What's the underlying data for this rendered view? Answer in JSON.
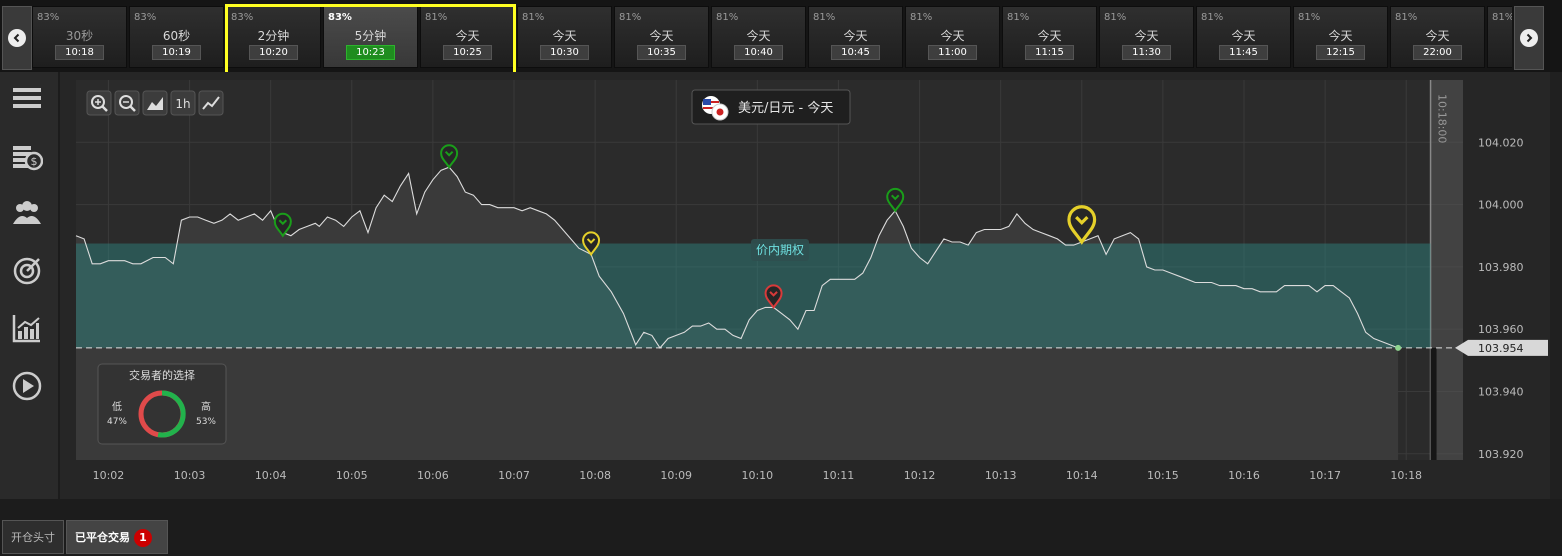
{
  "expiries": [
    {
      "pct": "83%",
      "label": "30秒",
      "time": "10:18"
    },
    {
      "pct": "83%",
      "label": "60秒",
      "time": "10:19"
    },
    {
      "pct": "83%",
      "label": "2分钟",
      "time": "10:20"
    },
    {
      "pct": "83%",
      "label": "5分钟",
      "time": "10:23",
      "selected": true
    },
    {
      "pct": "81%",
      "label": "今天",
      "time": "10:25"
    },
    {
      "pct": "81%",
      "label": "今天",
      "time": "10:30"
    },
    {
      "pct": "81%",
      "label": "今天",
      "time": "10:35"
    },
    {
      "pct": "81%",
      "label": "今天",
      "time": "10:40"
    },
    {
      "pct": "81%",
      "label": "今天",
      "time": "10:45"
    },
    {
      "pct": "81%",
      "label": "今天",
      "time": "11:00"
    },
    {
      "pct": "81%",
      "label": "今天",
      "time": "11:15"
    },
    {
      "pct": "81%",
      "label": "今天",
      "time": "11:30"
    },
    {
      "pct": "81%",
      "label": "今天",
      "time": "11:45"
    },
    {
      "pct": "81%",
      "label": "今天",
      "time": "12:15"
    },
    {
      "pct": "81%",
      "label": "今天",
      "time": "22:00"
    },
    {
      "pct": "81%",
      "label": "",
      "time": ""
    }
  ],
  "sidebar": {
    "icons": [
      "menu-icon",
      "coins-icon",
      "users-icon",
      "target-icon",
      "chart-icon",
      "play-icon"
    ]
  },
  "chart": {
    "toolbar": {
      "zoom_in": "zoom-in-icon",
      "zoom_out": "zoom-out-icon",
      "area": "area-chart-icon",
      "interval": "1h",
      "line": "line-chart-icon"
    },
    "asset_label": "美元/日元 - 今天",
    "expiry_marker": "10:18:00",
    "itm_label": "价内期权",
    "current_price_label": "103.954",
    "sentiment": {
      "title": "交易者的选择",
      "low_label": "低",
      "low_pct": "47%",
      "high_label": "高",
      "high_pct": "53%",
      "low_value": 47,
      "high_value": 53
    }
  },
  "chart_data": {
    "type": "line",
    "x_ticks": [
      "10:02",
      "10:03",
      "10:04",
      "10:05",
      "10:06",
      "10:07",
      "10:08",
      "10:09",
      "10:10",
      "10:11",
      "10:12",
      "10:13",
      "10:14",
      "10:15",
      "10:16",
      "10:17",
      "10:18"
    ],
    "y_ticks": [
      "104.020",
      "104.000",
      "103.980",
      "103.960",
      "103.940",
      "103.920"
    ],
    "ylim": [
      103.918,
      104.04
    ],
    "xlim_min": [
      1.6,
      18.7
    ],
    "current_price": 103.954,
    "itm_top": 103.9875,
    "expiry_min": 18.3,
    "series": [
      {
        "values": [
          [
            1.6,
            103.99
          ],
          [
            1.7,
            103.989
          ],
          [
            1.8,
            103.981
          ],
          [
            1.9,
            103.981
          ],
          [
            2.0,
            103.982
          ],
          [
            2.2,
            103.982
          ],
          [
            2.3,
            103.981
          ],
          [
            2.4,
            103.981
          ],
          [
            2.55,
            103.983
          ],
          [
            2.7,
            103.983
          ],
          [
            2.8,
            103.981
          ],
          [
            2.9,
            103.995
          ],
          [
            3.0,
            103.996
          ],
          [
            3.1,
            103.996
          ],
          [
            3.2,
            103.995
          ],
          [
            3.3,
            103.994
          ],
          [
            3.4,
            103.995
          ],
          [
            3.5,
            103.997
          ],
          [
            3.6,
            103.995
          ],
          [
            3.7,
            103.996
          ],
          [
            3.8,
            103.997
          ],
          [
            3.9,
            103.995
          ],
          [
            4.0,
            103.998
          ],
          [
            4.05,
            103.995
          ],
          [
            4.15,
            103.991
          ],
          [
            4.25,
            103.99
          ],
          [
            4.35,
            103.992
          ],
          [
            4.45,
            103.993
          ],
          [
            4.55,
            103.994
          ],
          [
            4.6,
            103.993
          ],
          [
            4.7,
            103.996
          ],
          [
            4.8,
            103.995
          ],
          [
            4.9,
            103.993
          ],
          [
            5.0,
            103.996
          ],
          [
            5.1,
            103.998
          ],
          [
            5.2,
            103.991
          ],
          [
            5.3,
            103.999
          ],
          [
            5.4,
            104.003
          ],
          [
            5.5,
            104.001
          ],
          [
            5.6,
            104.006
          ],
          [
            5.7,
            104.01
          ],
          [
            5.8,
            103.997
          ],
          [
            5.9,
            104.004
          ],
          [
            6.0,
            104.008
          ],
          [
            6.1,
            104.011
          ],
          [
            6.2,
            104.012
          ],
          [
            6.3,
            104.009
          ],
          [
            6.4,
            104.004
          ],
          [
            6.5,
            104.003
          ],
          [
            6.6,
            104.0
          ],
          [
            6.7,
            104.0
          ],
          [
            6.8,
            103.999
          ],
          [
            6.9,
            103.999
          ],
          [
            7.0,
            103.999
          ],
          [
            7.1,
            103.998
          ],
          [
            7.2,
            103.999
          ],
          [
            7.3,
            103.998
          ],
          [
            7.4,
            103.997
          ],
          [
            7.5,
            103.995
          ],
          [
            7.6,
            103.992
          ],
          [
            7.8,
            103.986
          ],
          [
            7.95,
            103.984
          ],
          [
            8.05,
            103.977
          ],
          [
            8.2,
            103.972
          ],
          [
            8.35,
            103.965
          ],
          [
            8.5,
            103.955
          ],
          [
            8.6,
            103.959
          ],
          [
            8.7,
            103.958
          ],
          [
            8.8,
            103.954
          ],
          [
            8.9,
            103.957
          ],
          [
            9.0,
            103.958
          ],
          [
            9.1,
            103.959
          ],
          [
            9.2,
            103.961
          ],
          [
            9.3,
            103.961
          ],
          [
            9.4,
            103.962
          ],
          [
            9.5,
            103.96
          ],
          [
            9.6,
            103.96
          ],
          [
            9.7,
            103.958
          ],
          [
            9.8,
            103.957
          ],
          [
            9.9,
            103.963
          ],
          [
            10.0,
            103.966
          ],
          [
            10.1,
            103.967
          ],
          [
            10.2,
            103.967
          ],
          [
            10.3,
            103.965
          ],
          [
            10.4,
            103.963
          ],
          [
            10.5,
            103.96
          ],
          [
            10.6,
            103.966
          ],
          [
            10.7,
            103.966
          ],
          [
            10.8,
            103.974
          ],
          [
            10.9,
            103.976
          ],
          [
            11.0,
            103.976
          ],
          [
            11.1,
            103.976
          ],
          [
            11.2,
            103.976
          ],
          [
            11.3,
            103.978
          ],
          [
            11.4,
            103.983
          ],
          [
            11.5,
            103.99
          ],
          [
            11.6,
            103.995
          ],
          [
            11.7,
            103.998
          ],
          [
            11.8,
            103.993
          ],
          [
            11.9,
            103.986
          ],
          [
            12.0,
            103.983
          ],
          [
            12.1,
            103.981
          ],
          [
            12.2,
            103.985
          ],
          [
            12.3,
            103.989
          ],
          [
            12.4,
            103.988
          ],
          [
            12.5,
            103.988
          ],
          [
            12.6,
            103.987
          ],
          [
            12.7,
            103.991
          ],
          [
            12.8,
            103.992
          ],
          [
            12.9,
            103.992
          ],
          [
            13.0,
            103.992
          ],
          [
            13.1,
            103.993
          ],
          [
            13.2,
            103.997
          ],
          [
            13.3,
            103.994
          ],
          [
            13.4,
            103.992
          ],
          [
            13.5,
            103.991
          ],
          [
            13.6,
            103.99
          ],
          [
            13.7,
            103.989
          ],
          [
            13.8,
            103.987
          ],
          [
            13.9,
            103.987
          ],
          [
            14.0,
            103.988
          ],
          [
            14.1,
            103.989
          ],
          [
            14.2,
            103.99
          ],
          [
            14.3,
            103.984
          ],
          [
            14.4,
            103.989
          ],
          [
            14.5,
            103.99
          ],
          [
            14.6,
            103.991
          ],
          [
            14.7,
            103.989
          ],
          [
            14.8,
            103.98
          ],
          [
            14.9,
            103.979
          ],
          [
            15.0,
            103.979
          ],
          [
            15.1,
            103.978
          ],
          [
            15.2,
            103.977
          ],
          [
            15.3,
            103.976
          ],
          [
            15.4,
            103.975
          ],
          [
            15.5,
            103.975
          ],
          [
            15.6,
            103.975
          ],
          [
            15.7,
            103.974
          ],
          [
            15.8,
            103.974
          ],
          [
            15.9,
            103.974
          ],
          [
            16.0,
            103.973
          ],
          [
            16.1,
            103.973
          ],
          [
            16.2,
            103.972
          ],
          [
            16.3,
            103.972
          ],
          [
            16.4,
            103.972
          ],
          [
            16.5,
            103.974
          ],
          [
            16.6,
            103.974
          ],
          [
            16.7,
            103.974
          ],
          [
            16.8,
            103.974
          ],
          [
            16.9,
            103.972
          ],
          [
            17.0,
            103.974
          ],
          [
            17.1,
            103.974
          ],
          [
            17.2,
            103.972
          ],
          [
            17.3,
            103.97
          ],
          [
            17.4,
            103.965
          ],
          [
            17.5,
            103.959
          ],
          [
            17.6,
            103.957
          ],
          [
            17.7,
            103.956
          ],
          [
            17.8,
            103.955
          ],
          [
            17.9,
            103.954
          ]
        ]
      }
    ],
    "markers": [
      {
        "min": 4.15,
        "price": 103.99,
        "color": "#1a9e1a",
        "size": "small"
      },
      {
        "min": 6.2,
        "price": 104.012,
        "color": "#1a9e1a",
        "size": "small"
      },
      {
        "min": 7.95,
        "price": 103.984,
        "color": "#e5d02a",
        "size": "small"
      },
      {
        "min": 10.2,
        "price": 103.967,
        "color": "#d83a3a",
        "size": "small"
      },
      {
        "min": 11.7,
        "price": 103.998,
        "color": "#1a9e1a",
        "size": "small"
      },
      {
        "min": 14.0,
        "price": 103.988,
        "color": "#e5d02a",
        "size": "large"
      }
    ]
  },
  "bottom": {
    "open_tab": "开仓头寸",
    "closed_tab": "已平仓交易",
    "closed_badge": "1"
  }
}
